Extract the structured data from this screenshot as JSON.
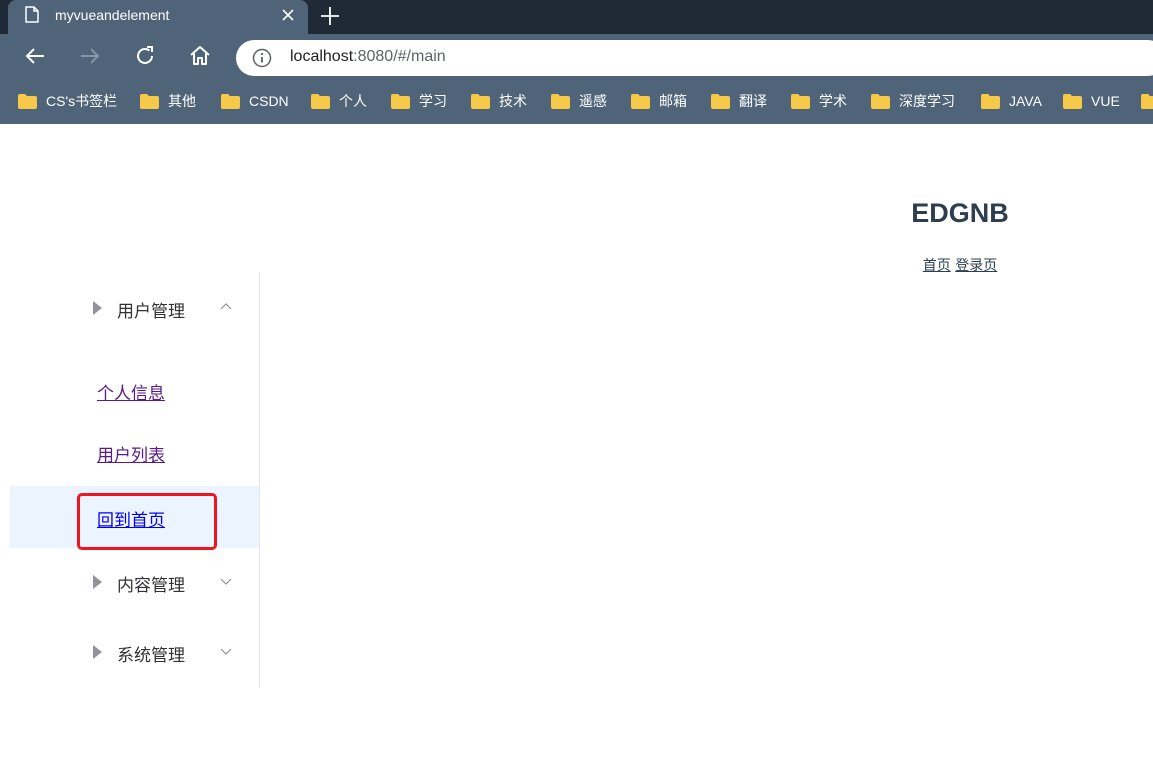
{
  "browser": {
    "tab_title": "myvueandelement",
    "url_host": "localhost",
    "url_path": ":8080/#/main",
    "bookmarks": [
      {
        "label": "CS's书签栏"
      },
      {
        "label": "其他"
      },
      {
        "label": "CSDN"
      },
      {
        "label": "个人"
      },
      {
        "label": "学习"
      },
      {
        "label": "技术"
      },
      {
        "label": "遥感"
      },
      {
        "label": "邮箱"
      },
      {
        "label": "翻译"
      },
      {
        "label": "学术"
      },
      {
        "label": "深度学习"
      },
      {
        "label": "JAVA"
      },
      {
        "label": "VUE"
      }
    ]
  },
  "page": {
    "title": "EDGNB",
    "links": {
      "home": "首页",
      "login": "登录页"
    }
  },
  "sidebar": {
    "user_menu": {
      "label": "用户管理",
      "items": [
        {
          "label": "个人信息"
        },
        {
          "label": "用户列表"
        },
        {
          "label": "回到首页"
        }
      ]
    },
    "content_menu": {
      "label": "内容管理"
    },
    "system_menu": {
      "label": "系统管理"
    }
  },
  "colors": {
    "chrome": "#4f6478",
    "tabstrip": "#202a36",
    "active_menu_bg": "#ecf5ff",
    "highlight": "#f0141e",
    "title_text": "#2c3e50"
  }
}
